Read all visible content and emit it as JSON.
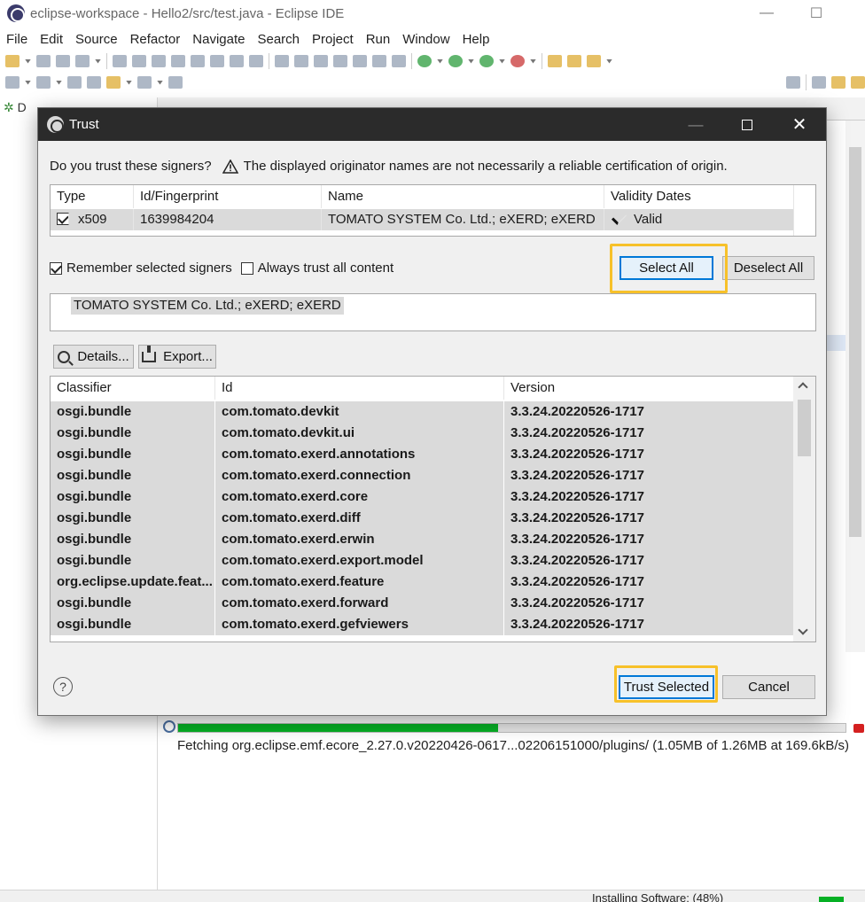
{
  "window": {
    "title": "eclipse-workspace - Hello2/src/test.java - Eclipse IDE",
    "minimize": "—",
    "maximize": "☐"
  },
  "menu": [
    "File",
    "Edit",
    "Source",
    "Refactor",
    "Navigate",
    "Search",
    "Project",
    "Run",
    "Window",
    "Help"
  ],
  "left_view": {
    "tab_label": "D"
  },
  "progress": {
    "fraction": 0.48,
    "text": "Fetching org.eclipse.emf.ecore_2.27.0.v20220426-0617...02206151000/plugins/ (1.05MB of 1.26MB at 169.6kB/s)"
  },
  "status": {
    "text": "Installing Software: (48%)"
  },
  "dialog": {
    "title": "Trust",
    "question": "Do you trust these signers?",
    "warning": "The displayed originator names are not necessarily a reliable certification of origin.",
    "signers_table": {
      "headers": [
        "Type",
        "Id/Fingerprint",
        "Name",
        "Validity Dates"
      ],
      "row": {
        "checked": true,
        "type": "x509",
        "fingerprint": "1639984204",
        "name": "TOMATO SYSTEM Co. Ltd.; eXERD; eXERD",
        "validity": "Valid"
      }
    },
    "remember_label": "Remember selected signers",
    "remember_checked": true,
    "always_trust_label": "Always trust all content",
    "always_trust_checked": false,
    "select_all": "Select All",
    "deselect_all": "Deselect All",
    "signer_detail": "TOMATO SYSTEM Co. Ltd.; eXERD; eXERD",
    "details_button": "Details...",
    "export_button": "Export...",
    "artifacts": {
      "headers": [
        "Classifier",
        "Id",
        "Version"
      ],
      "rows": [
        [
          "osgi.bundle",
          "com.tomato.devkit",
          "3.3.24.20220526-1717"
        ],
        [
          "osgi.bundle",
          "com.tomato.devkit.ui",
          "3.3.24.20220526-1717"
        ],
        [
          "osgi.bundle",
          "com.tomato.exerd.annotations",
          "3.3.24.20220526-1717"
        ],
        [
          "osgi.bundle",
          "com.tomato.exerd.connection",
          "3.3.24.20220526-1717"
        ],
        [
          "osgi.bundle",
          "com.tomato.exerd.core",
          "3.3.24.20220526-1717"
        ],
        [
          "osgi.bundle",
          "com.tomato.exerd.diff",
          "3.3.24.20220526-1717"
        ],
        [
          "osgi.bundle",
          "com.tomato.exerd.erwin",
          "3.3.24.20220526-1717"
        ],
        [
          "osgi.bundle",
          "com.tomato.exerd.export.model",
          "3.3.24.20220526-1717"
        ],
        [
          "org.eclipse.update.feat...",
          "com.tomato.exerd.feature",
          "3.3.24.20220526-1717"
        ],
        [
          "osgi.bundle",
          "com.tomato.exerd.forward",
          "3.3.24.20220526-1717"
        ],
        [
          "osgi.bundle",
          "com.tomato.exerd.gefviewers",
          "3.3.24.20220526-1717"
        ]
      ]
    },
    "help": "?",
    "trust_selected": "Trust Selected",
    "cancel": "Cancel"
  }
}
